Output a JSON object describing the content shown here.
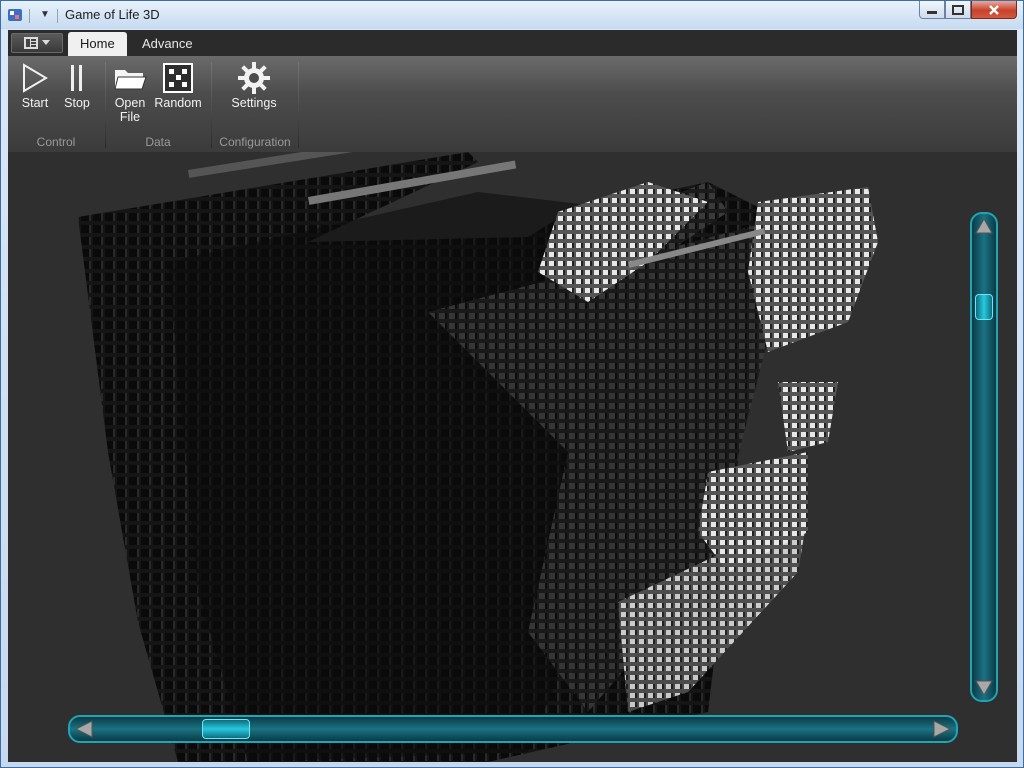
{
  "window": {
    "title": "Game of Life 3D"
  },
  "tabs": [
    {
      "label": "Home",
      "active": true
    },
    {
      "label": "Advance",
      "active": false
    }
  ],
  "ribbon": {
    "groups": [
      {
        "label": "Control",
        "buttons": [
          {
            "label": "Start",
            "icon": "play-icon"
          },
          {
            "label": "Stop",
            "icon": "pause-icon"
          }
        ]
      },
      {
        "label": "Data",
        "buttons": [
          {
            "label": "Open File",
            "icon": "folder-open-icon"
          },
          {
            "label": "Random",
            "icon": "dice-icon"
          }
        ]
      },
      {
        "label": "Configuration",
        "buttons": [
          {
            "label": "Settings",
            "icon": "gear-icon"
          }
        ]
      }
    ]
  },
  "viewport": {
    "description_icon": "3d-cells-view",
    "vertical_scroll_position": 0.2,
    "horizontal_scroll_position": 0.15
  },
  "colors": {
    "accent": "#1ea5b8",
    "ribbon": "#4c4c4c",
    "viewport": "#2f2f2f"
  }
}
